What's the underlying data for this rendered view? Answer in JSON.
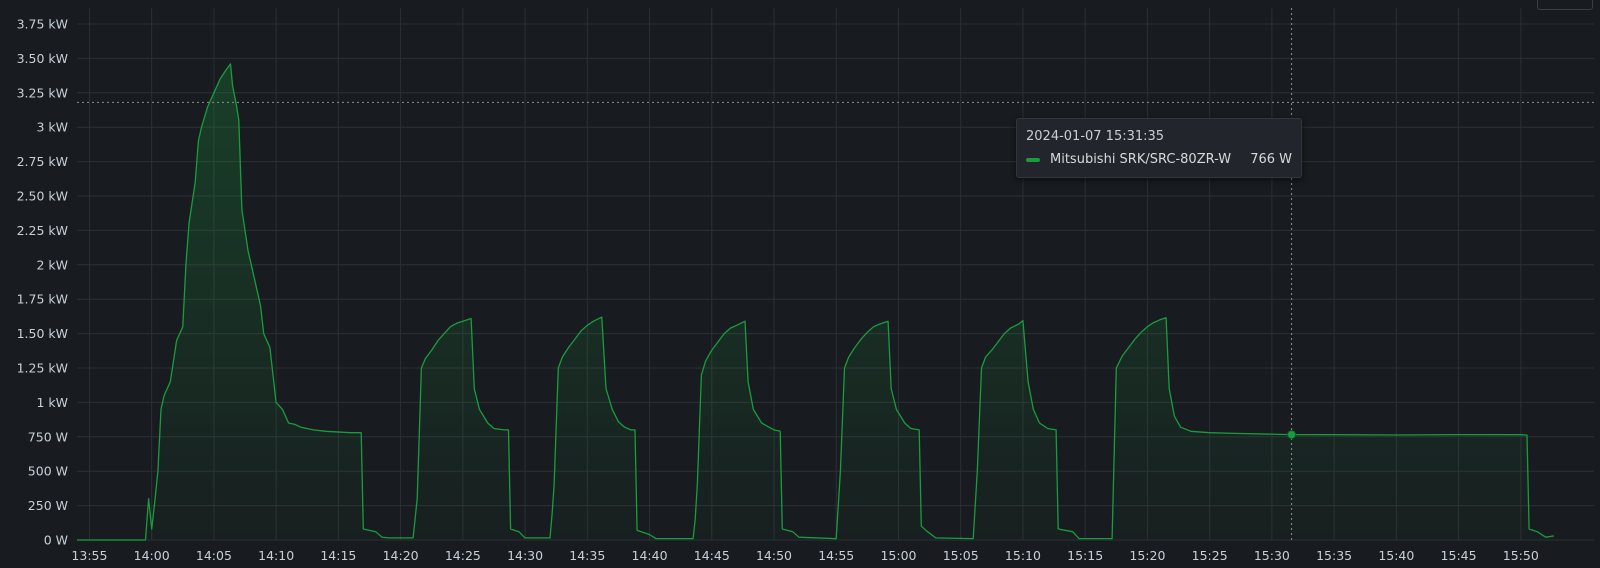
{
  "chart_data": {
    "type": "line",
    "title": "",
    "xlabel": "",
    "ylabel": "",
    "y_ticks": [
      "0 W",
      "250 W",
      "500 W",
      "750 W",
      "1 kW",
      "1.25 kW",
      "1.50 kW",
      "1.75 kW",
      "2 kW",
      "2.25 kW",
      "2.50 kW",
      "2.75 kW",
      "3 kW",
      "3.25 kW",
      "3.50 kW",
      "3.75 kW"
    ],
    "x_ticks": [
      "13:55",
      "14:00",
      "14:05",
      "14:10",
      "14:15",
      "14:20",
      "14:25",
      "14:30",
      "14:35",
      "14:40",
      "14:45",
      "14:50",
      "14:55",
      "15:00",
      "15:05",
      "15:10",
      "15:15",
      "15:20",
      "15:25",
      "15:30",
      "15:35",
      "15:40",
      "15:45",
      "15:50"
    ],
    "ylim_w": [
      0,
      3900
    ],
    "xlim": [
      "13:54:00",
      "15:52:40"
    ],
    "grid": true,
    "fill": "gradient-under-line",
    "series_color": "#1a9c3e",
    "series": [
      {
        "name": "Mitsubishi SRK/SRC-80ZR-W",
        "unit": "W",
        "points": [
          [
            "13:54:00",
            0
          ],
          [
            "13:59:30",
            0
          ],
          [
            "13:59:45",
            300
          ],
          [
            "14:00:00",
            80
          ],
          [
            "14:00:15",
            280
          ],
          [
            "14:00:30",
            500
          ],
          [
            "14:00:45",
            950
          ],
          [
            "14:01:00",
            1050
          ],
          [
            "14:01:30",
            1150
          ],
          [
            "14:02:00",
            1450
          ],
          [
            "14:02:30",
            1550
          ],
          [
            "14:02:45",
            2000
          ],
          [
            "14:03:00",
            2300
          ],
          [
            "14:03:30",
            2600
          ],
          [
            "14:03:45",
            2900
          ],
          [
            "14:04:00",
            3000
          ],
          [
            "14:04:30",
            3150
          ],
          [
            "14:05:00",
            3250
          ],
          [
            "14:05:30",
            3350
          ],
          [
            "14:06:00",
            3420
          ],
          [
            "14:06:20",
            3460
          ],
          [
            "14:06:30",
            3300
          ],
          [
            "14:06:50",
            3150
          ],
          [
            "14:07:00",
            3050
          ],
          [
            "14:07:15",
            2400
          ],
          [
            "14:07:45",
            2100
          ],
          [
            "14:08:00",
            2000
          ],
          [
            "14:08:15",
            1900
          ],
          [
            "14:08:30",
            1800
          ],
          [
            "14:08:45",
            1700
          ],
          [
            "14:09:00",
            1500
          ],
          [
            "14:09:30",
            1400
          ],
          [
            "14:09:45",
            1200
          ],
          [
            "14:10:00",
            1000
          ],
          [
            "14:10:30",
            950
          ],
          [
            "14:11:00",
            850
          ],
          [
            "14:11:30",
            840
          ],
          [
            "14:12:00",
            820
          ],
          [
            "14:13:00",
            800
          ],
          [
            "14:14:00",
            790
          ],
          [
            "14:16:00",
            780
          ],
          [
            "14:16:50",
            780
          ],
          [
            "14:17:00",
            80
          ],
          [
            "14:18:00",
            60
          ],
          [
            "14:18:30",
            20
          ],
          [
            "14:19:00",
            15
          ],
          [
            "14:21:00",
            15
          ],
          [
            "14:21:20",
            300
          ],
          [
            "14:21:40",
            1250
          ],
          [
            "14:22:00",
            1320
          ],
          [
            "14:22:30",
            1380
          ],
          [
            "14:23:00",
            1450
          ],
          [
            "14:23:30",
            1500
          ],
          [
            "14:24:00",
            1550
          ],
          [
            "14:24:30",
            1575
          ],
          [
            "14:25:00",
            1590
          ],
          [
            "14:25:40",
            1610
          ],
          [
            "14:25:55",
            1100
          ],
          [
            "14:26:20",
            950
          ],
          [
            "14:27:00",
            850
          ],
          [
            "14:27:30",
            810
          ],
          [
            "14:28:20",
            800
          ],
          [
            "14:28:40",
            800
          ],
          [
            "14:28:50",
            80
          ],
          [
            "14:29:30",
            60
          ],
          [
            "14:30:00",
            15
          ],
          [
            "14:32:00",
            15
          ],
          [
            "14:32:10",
            180
          ],
          [
            "14:32:20",
            400
          ],
          [
            "14:32:40",
            1250
          ],
          [
            "14:33:00",
            1330
          ],
          [
            "14:33:30",
            1400
          ],
          [
            "14:34:00",
            1460
          ],
          [
            "14:34:30",
            1520
          ],
          [
            "14:35:00",
            1560
          ],
          [
            "14:35:30",
            1590
          ],
          [
            "14:36:10",
            1620
          ],
          [
            "14:36:30",
            1100
          ],
          [
            "14:37:00",
            950
          ],
          [
            "14:37:30",
            860
          ],
          [
            "14:38:00",
            820
          ],
          [
            "14:38:30",
            800
          ],
          [
            "14:38:50",
            800
          ],
          [
            "14:39:00",
            70
          ],
          [
            "14:40:00",
            40
          ],
          [
            "14:40:30",
            10
          ],
          [
            "14:43:30",
            10
          ],
          [
            "14:43:40",
            150
          ],
          [
            "14:43:50",
            400
          ],
          [
            "14:44:10",
            1200
          ],
          [
            "14:44:30",
            1300
          ],
          [
            "14:45:00",
            1380
          ],
          [
            "14:45:30",
            1440
          ],
          [
            "14:46:00",
            1500
          ],
          [
            "14:46:30",
            1540
          ],
          [
            "14:47:00",
            1560
          ],
          [
            "14:47:40",
            1590
          ],
          [
            "14:47:55",
            1150
          ],
          [
            "14:48:20",
            950
          ],
          [
            "14:49:00",
            850
          ],
          [
            "14:50:00",
            800
          ],
          [
            "14:50:30",
            790
          ],
          [
            "14:50:40",
            80
          ],
          [
            "14:51:30",
            60
          ],
          [
            "14:52:00",
            20
          ],
          [
            "14:55:00",
            10
          ],
          [
            "14:55:20",
            500
          ],
          [
            "14:55:40",
            1250
          ],
          [
            "14:56:00",
            1330
          ],
          [
            "14:56:30",
            1400
          ],
          [
            "14:57:00",
            1460
          ],
          [
            "14:57:30",
            1510
          ],
          [
            "14:58:00",
            1550
          ],
          [
            "14:58:30",
            1570
          ],
          [
            "14:59:10",
            1590
          ],
          [
            "14:59:25",
            1100
          ],
          [
            "14:59:50",
            950
          ],
          [
            "15:00:30",
            850
          ],
          [
            "15:01:00",
            810
          ],
          [
            "15:01:40",
            800
          ],
          [
            "15:01:50",
            100
          ],
          [
            "15:02:20",
            60
          ],
          [
            "15:03:00",
            15
          ],
          [
            "15:06:00",
            10
          ],
          [
            "15:06:20",
            500
          ],
          [
            "15:06:40",
            1250
          ],
          [
            "15:07:00",
            1330
          ],
          [
            "15:07:30",
            1380
          ],
          [
            "15:08:00",
            1440
          ],
          [
            "15:08:30",
            1500
          ],
          [
            "15:09:00",
            1540
          ],
          [
            "15:09:40",
            1570
          ],
          [
            "15:10:00",
            1595
          ],
          [
            "15:10:25",
            1150
          ],
          [
            "15:10:50",
            950
          ],
          [
            "15:11:20",
            850
          ],
          [
            "15:12:00",
            810
          ],
          [
            "15:12:40",
            800
          ],
          [
            "15:12:50",
            80
          ],
          [
            "15:14:00",
            60
          ],
          [
            "15:14:30",
            10
          ],
          [
            "15:17:10",
            10
          ],
          [
            "15:17:30",
            1250
          ],
          [
            "15:18:00",
            1340
          ],
          [
            "15:18:30",
            1400
          ],
          [
            "15:19:00",
            1460
          ],
          [
            "15:19:30",
            1510
          ],
          [
            "15:20:00",
            1550
          ],
          [
            "15:20:30",
            1580
          ],
          [
            "15:21:00",
            1600
          ],
          [
            "15:21:30",
            1615
          ],
          [
            "15:21:45",
            1100
          ],
          [
            "15:22:10",
            900
          ],
          [
            "15:22:40",
            820
          ],
          [
            "15:23:30",
            790
          ],
          [
            "15:25:00",
            780
          ],
          [
            "15:27:00",
            775
          ],
          [
            "15:31:35",
            766
          ],
          [
            "15:35:00",
            765
          ],
          [
            "15:40:00",
            763
          ],
          [
            "15:45:00",
            766
          ],
          [
            "15:50:00",
            765
          ],
          [
            "15:50:30",
            762
          ],
          [
            "15:50:40",
            80
          ],
          [
            "15:51:20",
            60
          ],
          [
            "15:52:00",
            20
          ],
          [
            "15:52:40",
            30
          ]
        ]
      }
    ],
    "hover_crosshair": {
      "time": "15:31:35",
      "value_w": 766
    },
    "horizontal_crosshair_w": 3180
  },
  "tooltip": {
    "timestamp": "2024-01-07 15:31:35",
    "series_name": "Mitsubishi SRK/SRC-80ZR-W",
    "value": "766 W"
  }
}
